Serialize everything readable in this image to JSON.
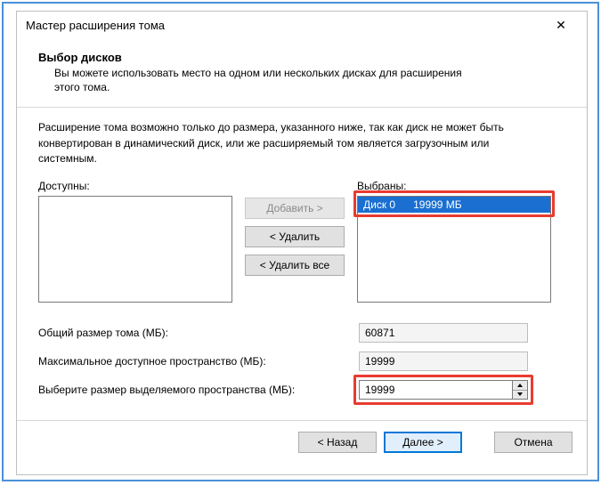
{
  "titlebar": {
    "title": "Мастер расширения тома",
    "close_icon": "✕"
  },
  "header": {
    "title": "Выбор дисков",
    "desc": "Вы можете использовать место на одном или нескольких дисках для расширения этого тома."
  },
  "note": "Расширение тома возможно только до размера, указанного ниже, так как диск не может быть конвертирован в динамический диск, или же расширяемый том является загрузочным или системным.",
  "picker": {
    "available_label": "Доступны:",
    "selected_label": "Выбраны:",
    "available_items": [],
    "selected_items": [
      {
        "label": "Диск 0      19999 МБ",
        "selected": true
      }
    ],
    "add_label": "Добавить >",
    "remove_label": "< Удалить",
    "remove_all_label": "< Удалить все"
  },
  "fields": {
    "total_label": "Общий размер тома (МБ):",
    "total_value": "60871",
    "max_label": "Максимальное доступное пространство (МБ):",
    "max_value": "19999",
    "select_label": "Выберите размер выделяемого пространства (МБ):",
    "select_value": "19999"
  },
  "footer": {
    "back": "< Назад",
    "next": "Далее >",
    "cancel": "Отмена"
  }
}
